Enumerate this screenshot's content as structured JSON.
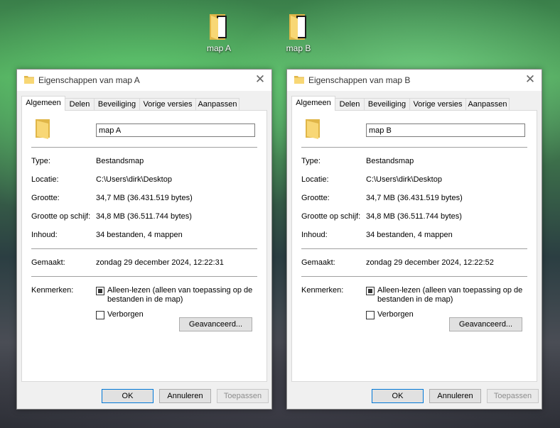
{
  "desktop": {
    "icons": [
      {
        "label": "map A"
      },
      {
        "label": "map B"
      }
    ]
  },
  "dialogs": [
    {
      "title": "Eigenschappen van map A",
      "tabs": [
        "Algemeen",
        "Delen",
        "Beveiliging",
        "Vorige versies",
        "Aanpassen"
      ],
      "name": "map A",
      "type_label": "Type:",
      "type_value": "Bestandsmap",
      "location_label": "Locatie:",
      "location_value": "C:\\Users\\dirk\\Desktop",
      "size_label": "Grootte:",
      "size_value": "34,7 MB (36.431.519 bytes)",
      "disk_label": "Grootte op schijf:",
      "disk_value": "34,8 MB (36.511.744 bytes)",
      "contents_label": "Inhoud:",
      "contents_value": "34 bestanden, 4 mappen",
      "created_label": "Gemaakt:",
      "created_value": "zondag 29 december 2024, 12:22:31",
      "attributes_label": "Kenmerken:",
      "readonly_label": "Alleen-lezen (alleen van toepassing op de bestanden in de map)",
      "hidden_label": "Verborgen",
      "advanced_label": "Geavanceerd...",
      "ok_label": "OK",
      "cancel_label": "Annuleren",
      "apply_label": "Toepassen"
    },
    {
      "title": "Eigenschappen van map B",
      "tabs": [
        "Algemeen",
        "Delen",
        "Beveiliging",
        "Vorige versies",
        "Aanpassen"
      ],
      "name": "map B",
      "type_label": "Type:",
      "type_value": "Bestandsmap",
      "location_label": "Locatie:",
      "location_value": "C:\\Users\\dirk\\Desktop",
      "size_label": "Grootte:",
      "size_value": "34,7 MB (36.431.519 bytes)",
      "disk_label": "Grootte op schijf:",
      "disk_value": "34,8 MB (36.511.744 bytes)",
      "contents_label": "Inhoud:",
      "contents_value": "34 bestanden, 4 mappen",
      "created_label": "Gemaakt:",
      "created_value": "zondag 29 december 2024, 12:22:52",
      "attributes_label": "Kenmerken:",
      "readonly_label": "Alleen-lezen (alleen van toepassing op de bestanden in de map)",
      "hidden_label": "Verborgen",
      "advanced_label": "Geavanceerd...",
      "ok_label": "OK",
      "cancel_label": "Annuleren",
      "apply_label": "Toepassen"
    }
  ],
  "icons": {
    "folder": "folder-icon",
    "close": "close-icon"
  },
  "colors": {
    "folder_yellow": "#f8d775",
    "folder_dark": "#e0b648"
  }
}
